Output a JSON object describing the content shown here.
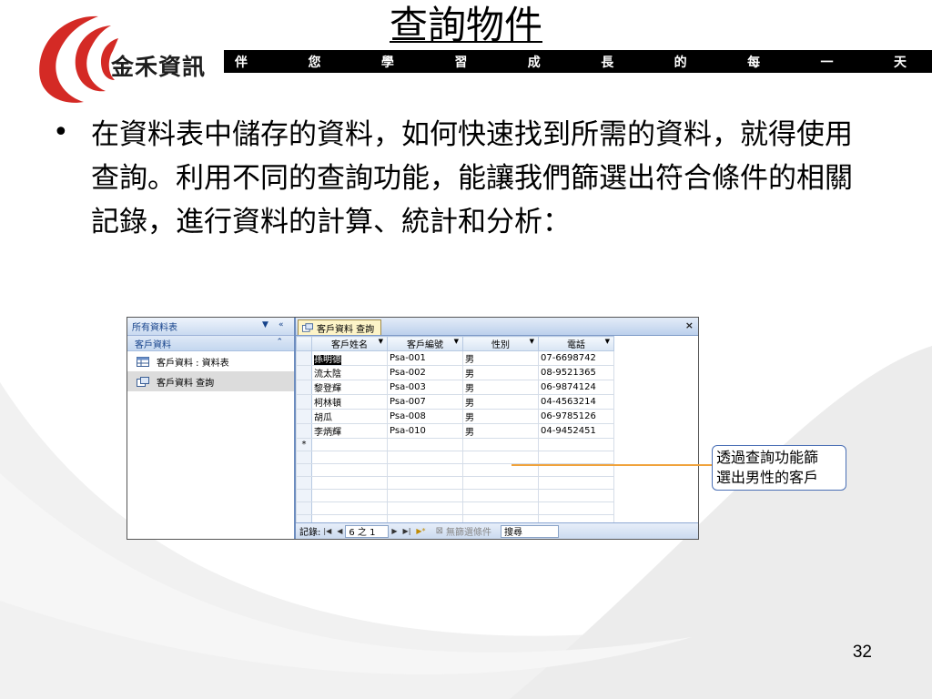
{
  "slide": {
    "title": "查詢物件",
    "brand": "金禾資訊",
    "slogan": [
      "伴",
      "您",
      "學",
      "習",
      "成",
      "長",
      "的",
      "每",
      "一",
      "天"
    ],
    "bullet_text": "在資料表中儲存的資料，如何快速找到所需的資料，就得使用查詢。利用不同的查詢功能，能讓我們篩選出符合條件的相關記錄，進行資料的計算、統計和分析：",
    "page_number": "32"
  },
  "access": {
    "nav": {
      "header": "所有資料表",
      "group": "客戶資料",
      "items": [
        {
          "label": "客戶資料 : 資料表",
          "icon": "table-icon",
          "selected": false
        },
        {
          "label": "客戶資料 查詢",
          "icon": "query-icon",
          "selected": true
        }
      ]
    },
    "tab": {
      "label": "客戶資料 查詢"
    },
    "columns": [
      "客戶姓名",
      "客戶編號",
      "性別",
      "電話"
    ],
    "rows": [
      [
        "孫明德",
        "Psa-001",
        "男",
        "07-6698742"
      ],
      [
        "流太陰",
        "Psa-002",
        "男",
        "08-9521365"
      ],
      [
        "黎登輝",
        "Psa-003",
        "男",
        "06-9874124"
      ],
      [
        "柯林頓",
        "Psa-007",
        "男",
        "04-4563214"
      ],
      [
        "胡瓜",
        "Psa-008",
        "男",
        "06-9785126"
      ],
      [
        "李炳輝",
        "Psa-010",
        "男",
        "04-9452451"
      ]
    ],
    "new_row_marker": "*",
    "record_bar": {
      "label": "記錄:",
      "position": "6 之 1",
      "filter": "無篩選條件",
      "search": "搜尋"
    }
  },
  "callout": {
    "line1": "透過查詢功能篩",
    "line2": "選出男性的客戶"
  },
  "colors": {
    "logo_red": "#d42a25",
    "slogan_bar": "#000000",
    "callout_line": "#f0a23b",
    "callout_border": "#4a6fb5"
  }
}
